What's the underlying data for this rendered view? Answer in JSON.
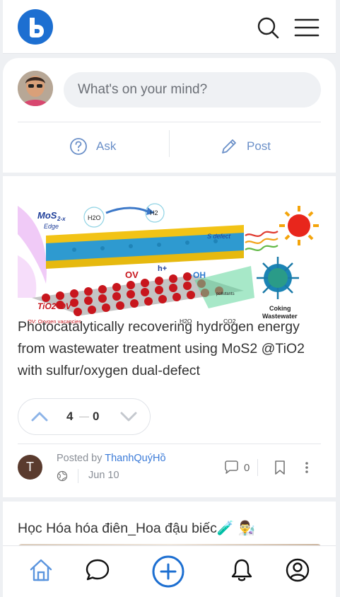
{
  "composer": {
    "placeholder": "What's on your mind?",
    "ask_label": "Ask",
    "post_label": "Post"
  },
  "post1": {
    "image_labels": {
      "mos2": "MoS",
      "mos2_sub": "2-x",
      "edge": "Edge",
      "h2o_top": "H2O",
      "h2": "H2",
      "s_defect": "S defect",
      "ov": "OV",
      "h_plus": "h+",
      "oh": "·OH",
      "tio2": "TiO2-OV",
      "ov_note": "OV: Oxygen vacancies",
      "pollutants": "pollutants",
      "h2o_bottom": "H2O",
      "co2": "CO2",
      "coking": "Coking",
      "wastewater": "Wastewater"
    },
    "title": "Photocatalytically recovering hydrogen energy from wastewater treatment using MoS2 @TiO2 with sulfur/oxygen dual-defect",
    "upvotes": "4",
    "downvotes": "0",
    "author_initial": "T",
    "posted_by_prefix": "Posted by ",
    "author": "ThanhQuýHồ",
    "date": "Jun 10",
    "comments": "0"
  },
  "post2": {
    "title": "Học Hóa hóa điên_Hoa đậu biếc🧪 👨‍🔬"
  },
  "colors": {
    "brand": "#1d6fd1",
    "accent_text": "#3b7bd8",
    "action_text": "#6a8fc8",
    "vote_arrow": "#8db4e8"
  }
}
